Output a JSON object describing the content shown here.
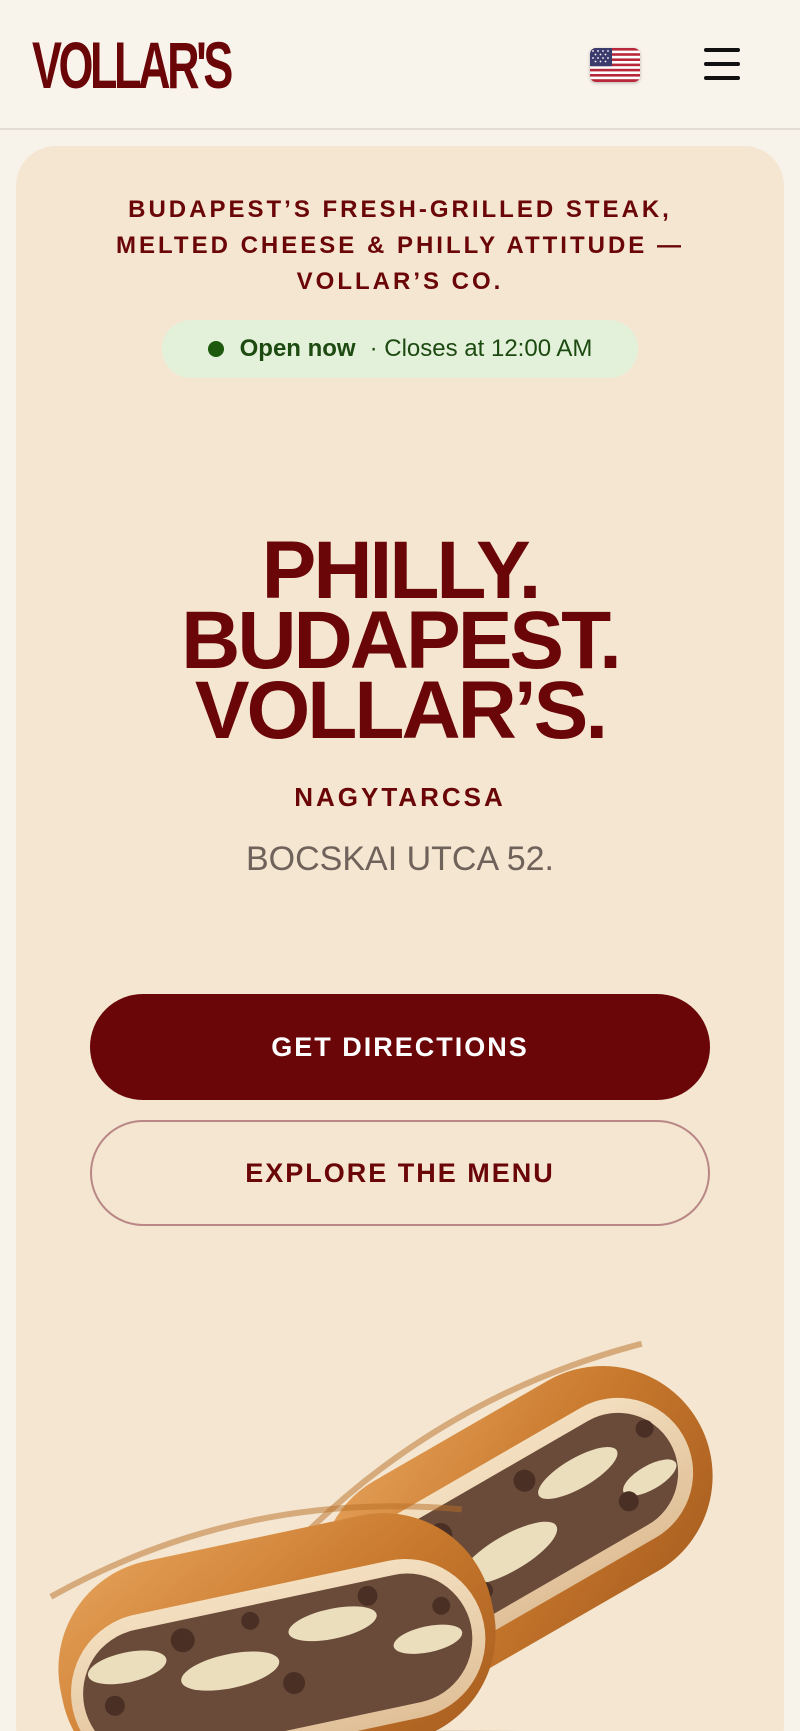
{
  "header": {
    "logo_text": "VOLLAR'S",
    "language_flag": "us-flag-icon",
    "menu_icon": "hamburger-menu-icon"
  },
  "hero_card": {
    "tagline": "BUDAPEST’S FRESH-GRILLED STEAK, MELTED CHEESE & PHILLY ATTITUDE — VOLLAR’S CO.",
    "status": {
      "open_label": "Open now",
      "close_label": "· Closes at 12:00 AM"
    },
    "headline": {
      "line1": "PHILLY.",
      "line2": "BUDAPEST.",
      "line3": "VOLLAR’S."
    },
    "city": "NAGYTARCSA",
    "address": "BOCSKAI UTCA 52.",
    "primary_button": "GET DIRECTIONS",
    "secondary_button": "EXPLORE THE MENU",
    "image": "philly-cheesesteak-sandwich-image"
  },
  "colors": {
    "brand": "#6a0508",
    "page_bg": "#f7f2ea",
    "card_bg": "#f4e6d1",
    "status_bg": "#e3f1da",
    "status_text": "#1d4a10"
  }
}
